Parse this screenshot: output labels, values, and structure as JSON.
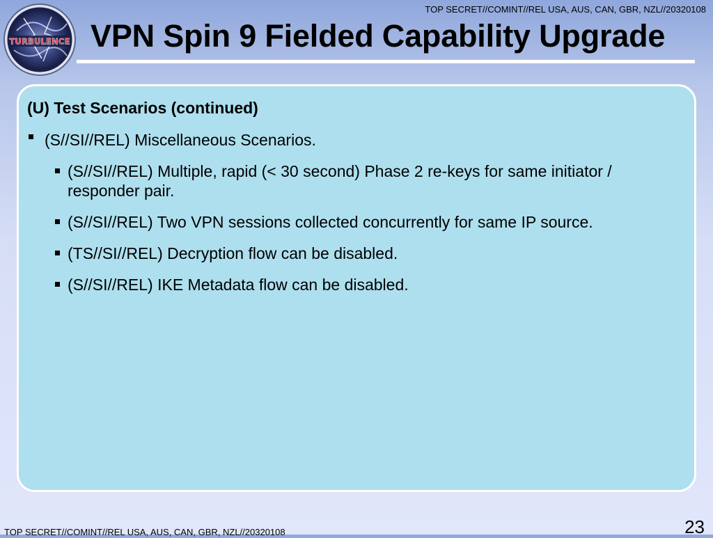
{
  "classification_top": "TOP SECRET//COMINT//REL USA, AUS, CAN, GBR, NZL//20320108",
  "logo": {
    "icon": "turbulence-logo-icon",
    "text": "TURBULENCE"
  },
  "title": "VPN Spin 9 Fielded Capability Upgrade",
  "content": {
    "heading": "(U) Test Scenarios (continued)",
    "bullet": "(S//SI//REL) Miscellaneous Scenarios.",
    "sub_bullets": [
      "(S//SI//REL) Multiple, rapid (< 30 second) Phase 2 re-keys for same initiator / responder pair.",
      "(S//SI//REL) Two VPN sessions collected concurrently for same IP source.",
      "(TS//SI//REL) Decryption flow can be disabled.",
      "(S//SI//REL) IKE Metadata flow can be disabled."
    ]
  },
  "classification_bottom": "TOP SECRET//COMINT//REL USA, AUS, CAN, GBR, NZL//20320108",
  "page_number": "23",
  "colors": {
    "panel_background": "#aedfee",
    "panel_border": "#ffffff",
    "logo_ring": "#2a2f63",
    "logo_text": "#e8323c"
  }
}
